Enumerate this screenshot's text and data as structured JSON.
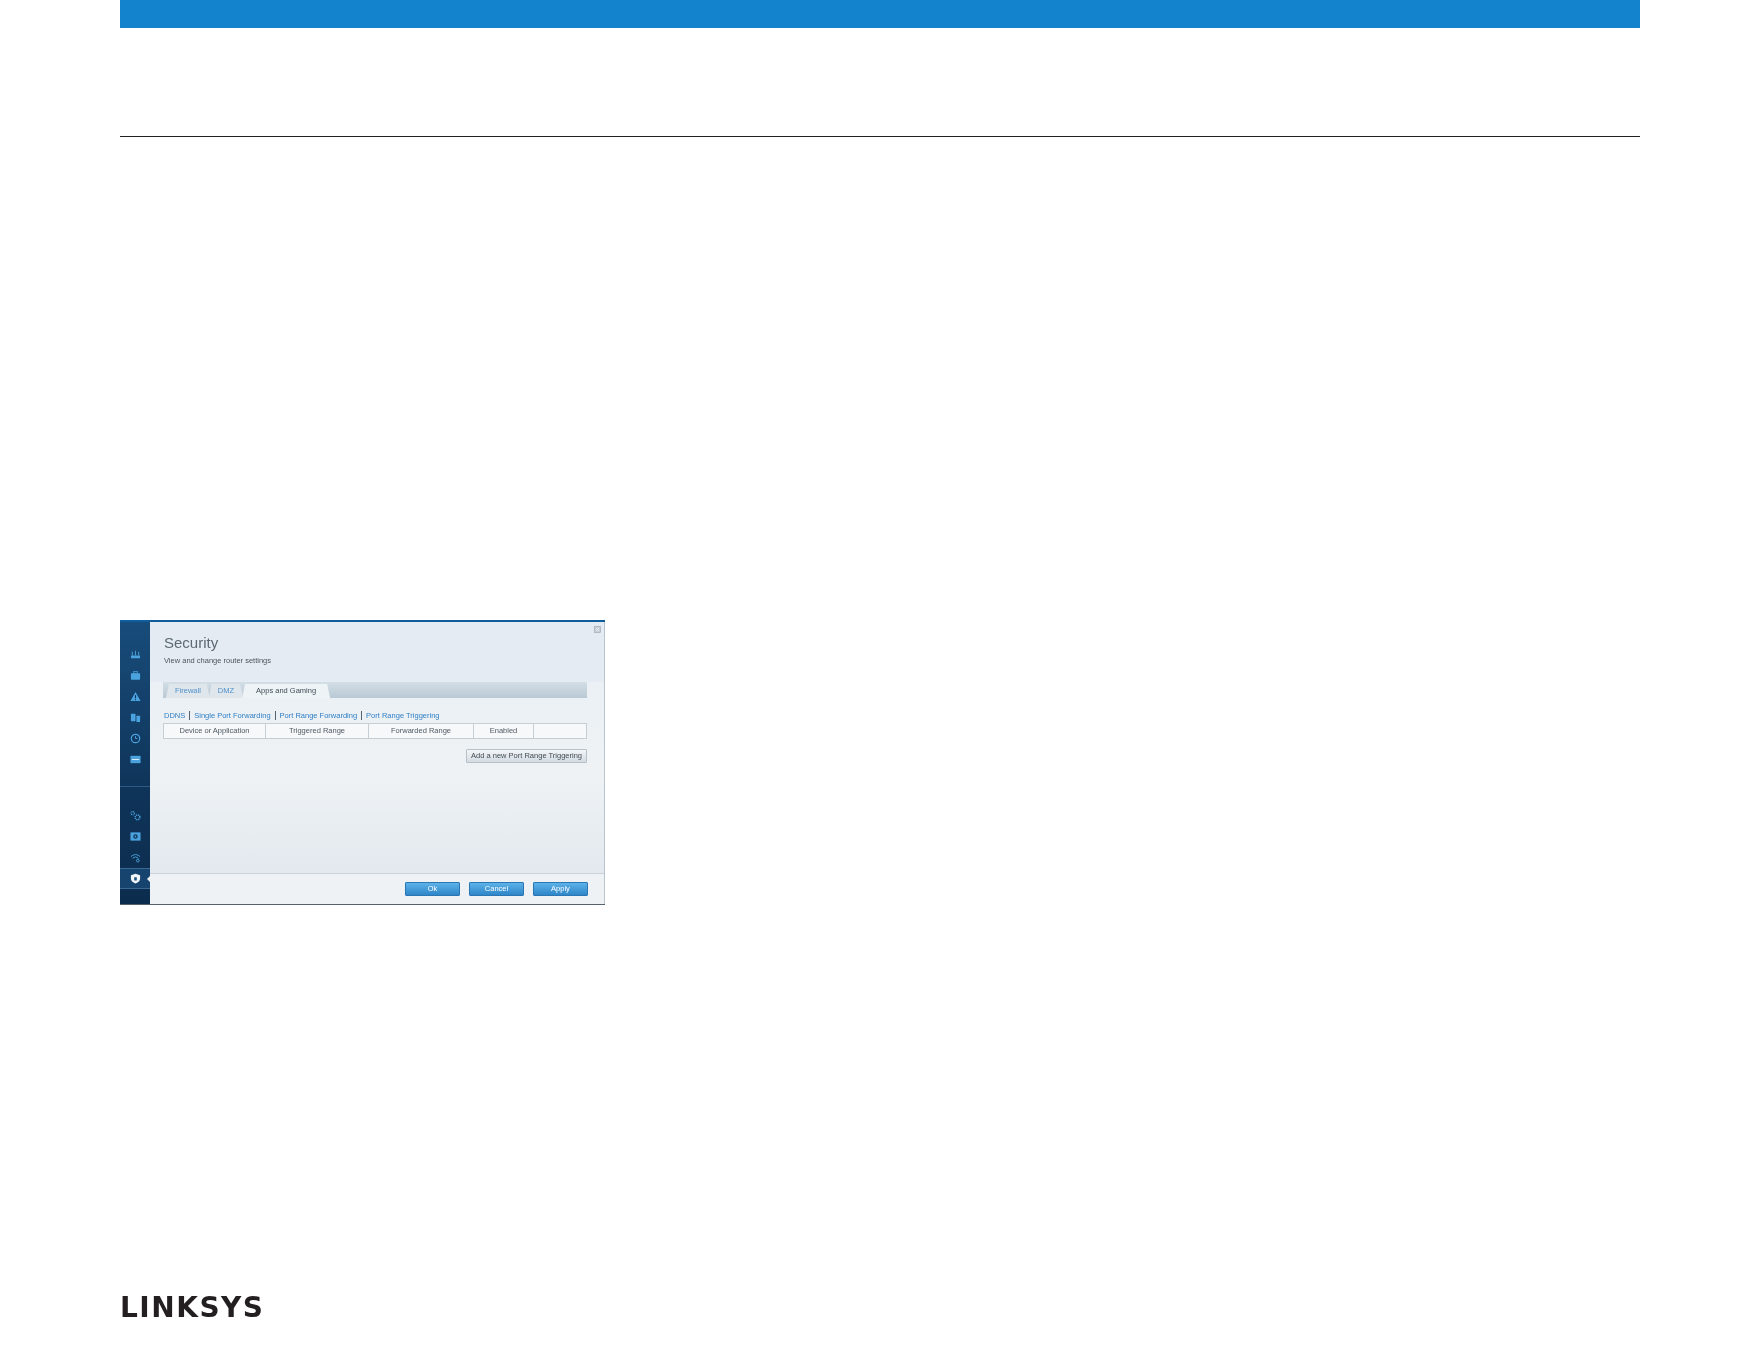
{
  "screenshot": {
    "sidebar": {
      "groups": [
        {
          "items": [
            {
              "kind": "router",
              "selected": false
            },
            {
              "kind": "briefcase",
              "selected": false
            },
            {
              "kind": "warning",
              "selected": false
            },
            {
              "kind": "devices",
              "selected": false
            },
            {
              "kind": "clock",
              "selected": false
            },
            {
              "kind": "screen",
              "selected": false
            }
          ]
        },
        {
          "items": [
            {
              "kind": "gears",
              "selected": false
            },
            {
              "kind": "drive",
              "selected": false
            },
            {
              "kind": "wifi",
              "selected": false
            },
            {
              "kind": "shield",
              "selected": true
            }
          ]
        }
      ]
    },
    "title": "Security",
    "subtitle": "View and change router settings",
    "tabs": [
      {
        "label": "Firewall",
        "selected": false
      },
      {
        "label": "DMZ",
        "selected": false
      },
      {
        "label": "Apps and Gaming",
        "selected": true
      }
    ],
    "sub_links": [
      "DDNS",
      "Single Port Forwarding",
      "Port Range Forwarding",
      "Port Range Triggering"
    ],
    "table": {
      "columns": [
        "Device or Application",
        "Triggered Range",
        "Forwarded Range",
        "Enabled"
      ]
    },
    "add_button": "Add a new Port Range Triggering",
    "footer_buttons": [
      "Ok",
      "Cancel",
      "Apply"
    ]
  },
  "logo": "LINKSYS"
}
